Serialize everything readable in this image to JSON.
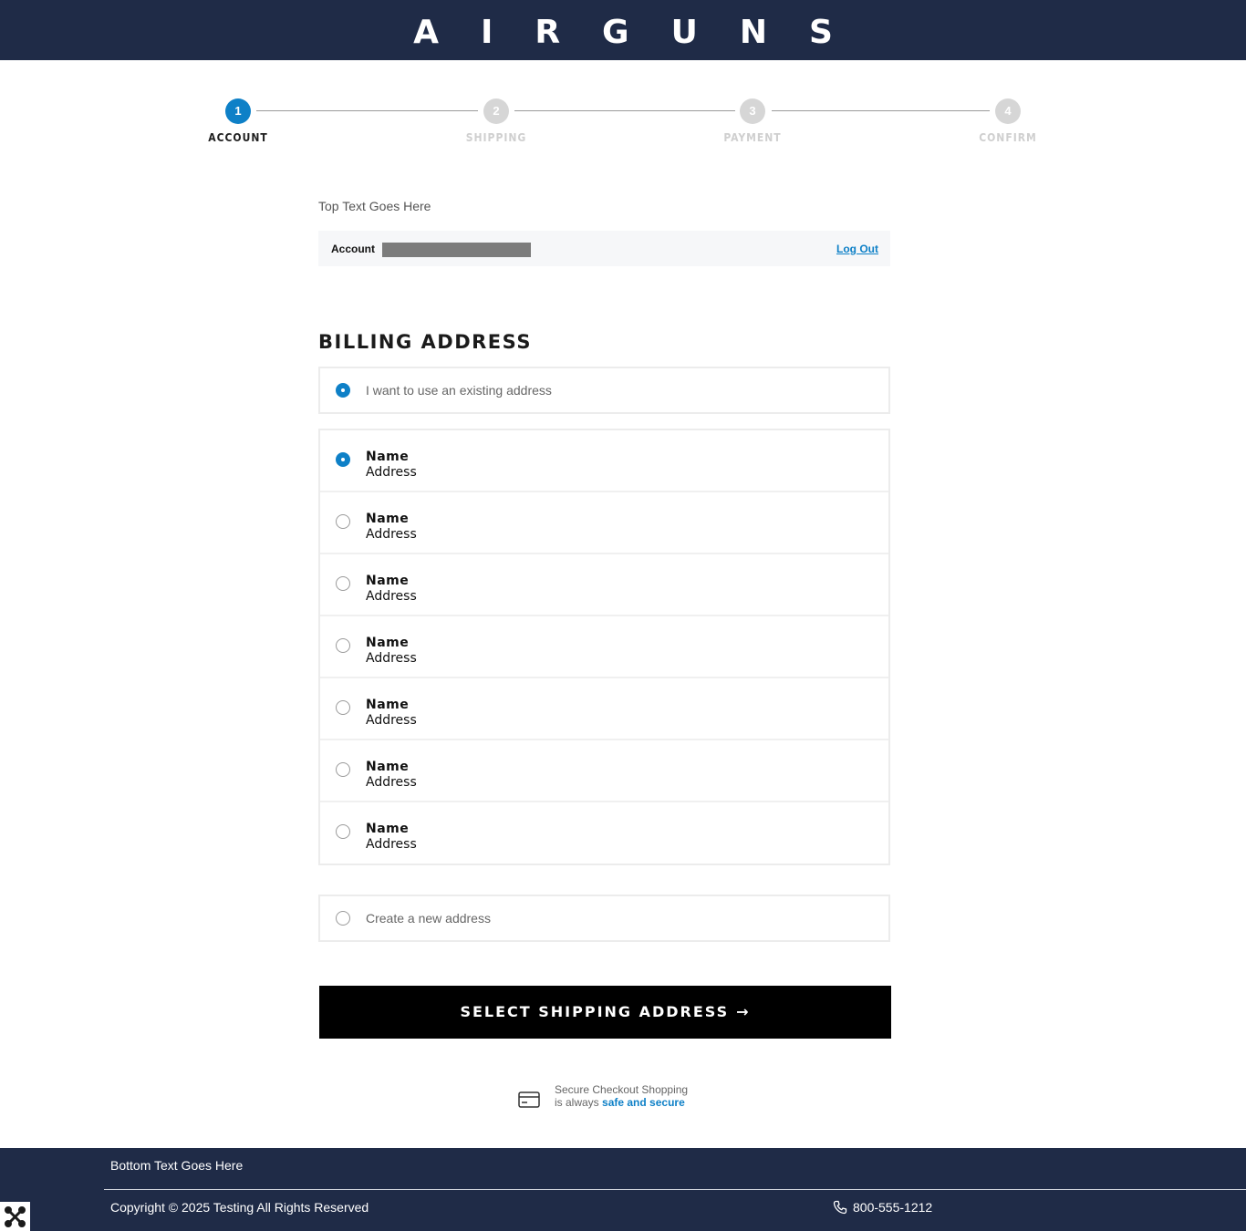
{
  "header": {
    "logo": "AIRGUNS"
  },
  "stepper": {
    "steps": [
      {
        "number": "1",
        "label": "ACCOUNT"
      },
      {
        "number": "2",
        "label": "SHIPPING"
      },
      {
        "number": "3",
        "label": "PAYMENT"
      },
      {
        "number": "4",
        "label": "CONFIRM"
      }
    ],
    "active_step": "1"
  },
  "top_text": "Top Text Goes Here",
  "account_bar": {
    "label": "Account",
    "logout": "Log Out"
  },
  "billing": {
    "heading": "BILLING ADDRESS",
    "existing_option": "I want to use an existing address",
    "addresses": [
      {
        "name": "Name",
        "address": "Address",
        "selected": true
      },
      {
        "name": "Name",
        "address": "Address",
        "selected": false
      },
      {
        "name": "Name",
        "address": "Address",
        "selected": false
      },
      {
        "name": "Name",
        "address": "Address",
        "selected": false
      },
      {
        "name": "Name",
        "address": "Address",
        "selected": false
      },
      {
        "name": "Name",
        "address": "Address",
        "selected": false
      },
      {
        "name": "Name",
        "address": "Address",
        "selected": false
      }
    ],
    "create_option": "Create a new address"
  },
  "cta": {
    "label": "SELECT SHIPPING ADDRESS",
    "arrow": "→"
  },
  "secure": {
    "line1": "Secure Checkout Shopping",
    "line2_prefix": "is always",
    "line2_strong": "safe and secure",
    "icon": "credit-card-icon"
  },
  "footer": {
    "bottom_text": "Bottom Text Goes Here",
    "copyright": "Copyright © 2025 Testing All Rights Reserved",
    "phone": "800-555-1212",
    "phone_icon": "phone-icon"
  },
  "colors": {
    "navy": "#1f2b47",
    "accent": "#0e80c7",
    "button": "#000000"
  }
}
